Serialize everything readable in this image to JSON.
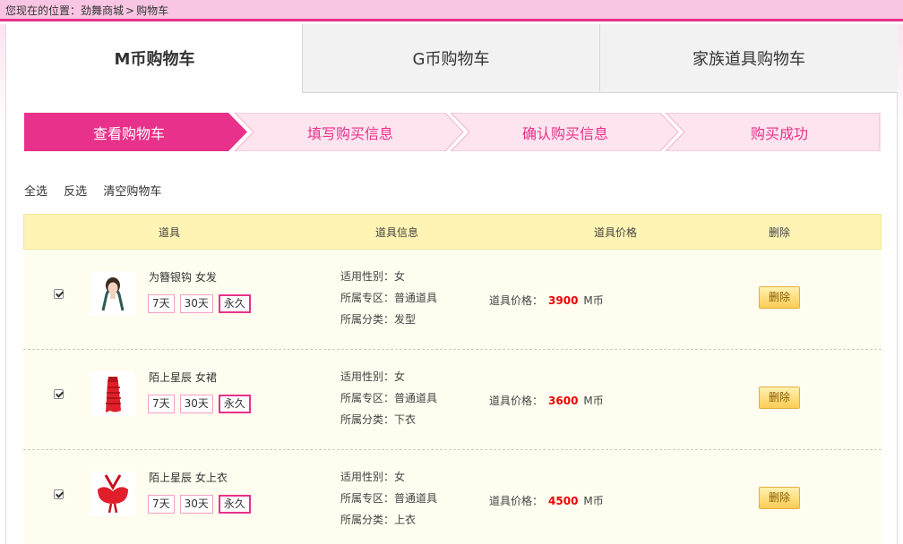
{
  "breadcrumb": {
    "prefix": "您现在的位置：",
    "home": "劲舞商城",
    "separator": ">",
    "current": "购物车"
  },
  "tabs": [
    {
      "label": "M币购物车",
      "active": true
    },
    {
      "label": "G币购物车",
      "active": false
    },
    {
      "label": "家族道具购物车",
      "active": false
    }
  ],
  "steps": [
    {
      "label": "查看购物车",
      "active": true
    },
    {
      "label": "填写购买信息",
      "active": false
    },
    {
      "label": "确认购买信息",
      "active": false
    },
    {
      "label": "购买成功",
      "active": false
    }
  ],
  "selection": {
    "select_all": "全选",
    "invert": "反选",
    "clear": "清空购物车"
  },
  "table": {
    "headers": [
      "道具",
      "道具信息",
      "道具价格",
      "删除"
    ],
    "price_label": "道具价格：",
    "currency": "M币",
    "delete_label": "删除",
    "durations": [
      "7天",
      "30天",
      "永久"
    ],
    "rows": [
      {
        "name": "为簪银钩 女发",
        "thumb_icon": "hair-item-icon",
        "checked": true,
        "gender": "适用性别：女",
        "zone": "所属专区：普通道具",
        "category": "所属分类：发型",
        "price": "3900",
        "selected_duration": "永久"
      },
      {
        "name": "陌上星辰 女裙",
        "thumb_icon": "skirt-item-icon",
        "checked": true,
        "gender": "适用性别：女",
        "zone": "所属专区：普通道具",
        "category": "所属分类：下衣",
        "price": "3600",
        "selected_duration": "永久"
      },
      {
        "name": "陌上星辰 女上衣",
        "thumb_icon": "top-item-icon",
        "checked": true,
        "gender": "适用性别：女",
        "zone": "所属专区：普通道具",
        "category": "所属分类：上衣",
        "price": "4500",
        "selected_duration": "永久"
      }
    ]
  },
  "colors": {
    "accent": "#e8318a",
    "step_inactive_bg": "#fde4ef",
    "header_bg": "#fff4b4",
    "row_bg": "#fffdef",
    "price": "#ee0000"
  }
}
